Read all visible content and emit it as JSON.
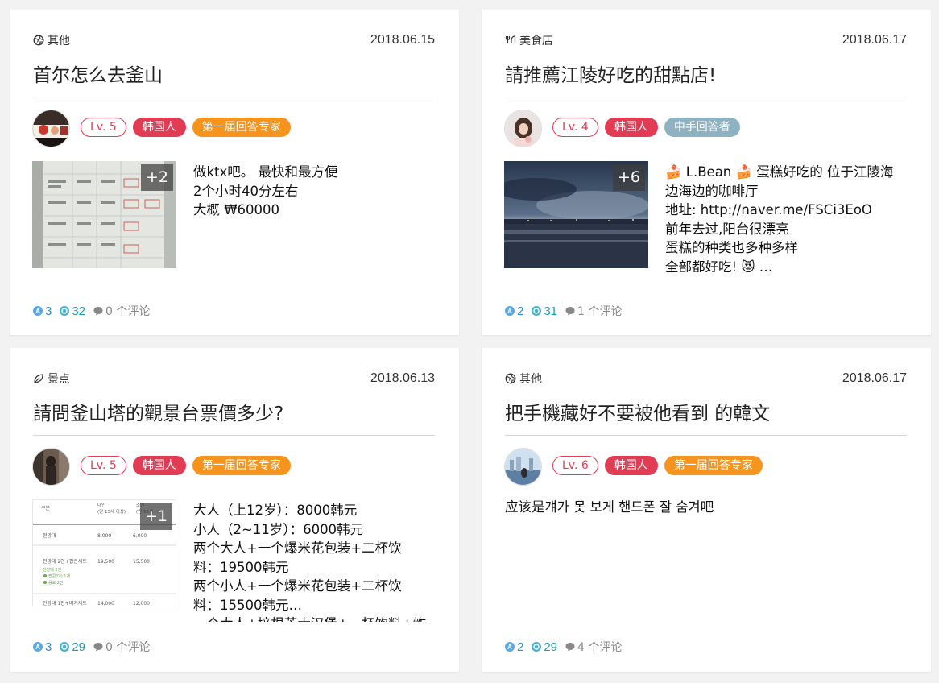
{
  "cards": [
    {
      "category": "其他",
      "category_icon": "globe-icon",
      "date": "2018.06.15",
      "title": "首尔怎么去釜山",
      "level": "Lv. 5",
      "nationality": "韩国人",
      "role": "第一届回答专家",
      "more_images": "+2",
      "answer_lines": [
        "做ktx吧。 最快和最方便",
        "2个小时40分左右",
        "大概 ₩60000"
      ],
      "stats": {
        "answers": "3",
        "views": "32",
        "comments": "0 个评论"
      }
    },
    {
      "category": "美食店",
      "category_icon": "utensils-icon",
      "date": "2018.06.17",
      "title": "請推薦江陵好吃的甜點店!",
      "level": "Lv. 4",
      "nationality": "韩国人",
      "role": "中手回答者",
      "more_images": "+6",
      "answer_lines": [
        "🍰 L.Bean 🍰 蛋糕好吃的 位于江陵海",
        "边海边的咖啡厅",
        "地址: http://naver.me/FSCi3EoO",
        "前年去过,阳台很漂亮",
        "蛋糕的种类也多种多样",
        "全部都好吃! 😻 …"
      ],
      "stats": {
        "answers": "2",
        "views": "31",
        "comments": "1 个评论"
      }
    },
    {
      "category": "景点",
      "category_icon": "leaf-icon",
      "date": "2018.06.13",
      "title": "請問釜山塔的觀景台票價多少?",
      "level": "Lv. 5",
      "nationality": "韩国人",
      "role": "第一届回答专家",
      "more_images": "+1",
      "answer_lines": [
        "大人（上12岁）：8000韩元",
        "小人（2~11岁）：6000韩元",
        "两个大人+一个爆米花包装+二杯饮",
        "料：19500韩元",
        "两个小人+一个爆米花包装+二杯饮",
        "料：15500韩元…",
        "一个大人+培根芝士汉堡+一杯饮料+炸"
      ],
      "thumb_table": {
        "headers": [
          "구분",
          "대인\n(만 13세 이상)",
          "소인\n(만 12세"
        ],
        "rows": [
          [
            "전망대",
            "8,000",
            "6,000"
          ],
          [
            "전망대 2인+팝콘세트",
            "19,500",
            "15,500"
          ],
          [
            "전망대 1인+버거세트",
            "14,000",
            "12,000"
          ]
        ],
        "green_notes": [
          "전망대 2인",
          "팝콘(대) 1개",
          "음료 2잔"
        ]
      },
      "stats": {
        "answers": "3",
        "views": "29",
        "comments": "0 个评论"
      }
    },
    {
      "category": "其他",
      "category_icon": "globe-icon",
      "date": "2018.06.17",
      "title": "把手機藏好不要被他看到 的韓文",
      "level": "Lv. 6",
      "nationality": "韩国人",
      "role": "第一届回答专家",
      "answer_lines": [
        "应该是걔가 못 보게 핸드폰 잘 숨겨吧"
      ],
      "stats": {
        "answers": "2",
        "views": "29",
        "comments": "4 个评论"
      }
    }
  ],
  "colors": {
    "badge_red": "#e23b54",
    "badge_orange": "#f7941d",
    "badge_blue_gray": "#8fb2c3",
    "stat_blue": "#2b8fd6",
    "stat_teal": "#1c9bb9"
  }
}
